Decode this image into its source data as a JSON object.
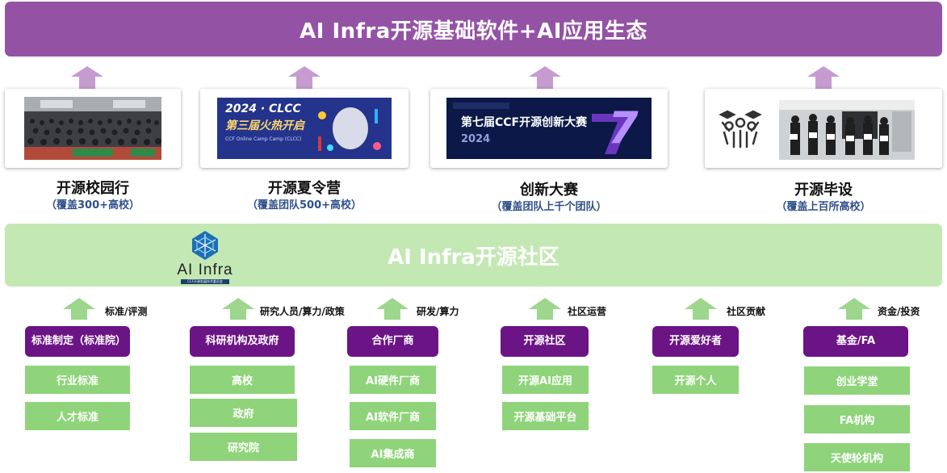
{
  "top_banner": {
    "title": "AI Infra开源基础软件+AI应用生态"
  },
  "programs": [
    {
      "title": "开源校园行",
      "subtitle": "（覆盖300+高校）"
    },
    {
      "title": "开源夏令营",
      "subtitle": "（覆盖团队500+高校）"
    },
    {
      "title": "创新大赛",
      "subtitle": "（覆盖团队上千个团队）"
    },
    {
      "title": "开源毕设",
      "subtitle": "（覆盖上百所高校）"
    }
  ],
  "photos": {
    "camp_line1": "2024 · CLCC",
    "camp_line2": "第三届火热开启",
    "camp_line3": "CCF Online Camp Camp (CLCC)",
    "contest_line1": "第七届CCF开源创新大赛",
    "contest_year": "2024",
    "contest_number": "7"
  },
  "community": {
    "title": "AI Infra开源社区",
    "logo_text": "AI Infra",
    "logo_sub": "CCF开源发展技术委员会"
  },
  "columns": [
    {
      "label": "标准/评测",
      "header": "标准制定（标准院）",
      "items": [
        "行业标准",
        "人才标准"
      ]
    },
    {
      "label": "研究人员/算力/政策",
      "header": "科研机构及政府",
      "items": [
        "高校",
        "政府",
        "研究院"
      ]
    },
    {
      "label": "研发/算力",
      "header": "合作厂商",
      "items": [
        "AI硬件厂商",
        "AI软件厂商",
        "AI集成商"
      ]
    },
    {
      "label": "社区运营",
      "header": "开源社区",
      "items": [
        "开源AI应用",
        "开源基础平台"
      ]
    },
    {
      "label": "社区贡献",
      "header": "开源爱好者",
      "items": [
        "开源个人"
      ]
    },
    {
      "label": "资金/投资",
      "header": "基金/FA",
      "items": [
        "创业学堂",
        "FA机构",
        "天使轮机构"
      ]
    }
  ],
  "colors": {
    "banner_purple": "#9452a5",
    "arrow_purple": "#c69bd0",
    "community_green": "#c3e8b4",
    "arrow_green": "#9dd68d",
    "box_purple": "#6b1485",
    "box_green": "#8fd47a",
    "subtitle_blue": "#2e4f8c"
  }
}
